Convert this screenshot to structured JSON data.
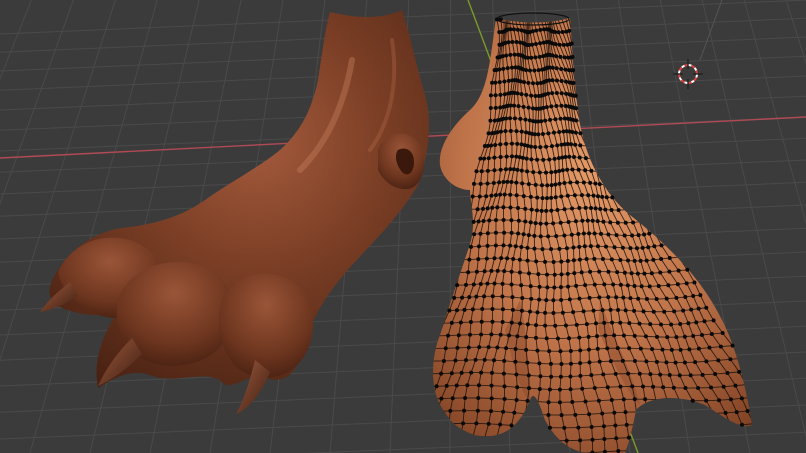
{
  "viewport": {
    "name": "3D Viewport",
    "background_color": "#3b3b3b",
    "grid_color": "#4a4a4a",
    "x_axis_color": "#b04a55",
    "y_axis_color": "#7c9a2a"
  },
  "objects": [
    {
      "id": "sculpted-paw",
      "kind": "sculpt",
      "shading": "smooth",
      "color": "#7a3e25"
    },
    {
      "id": "retopo-paw",
      "kind": "mesh",
      "mode": "edit",
      "shading": "smooth",
      "color": "#c0744a",
      "wire_color": "#111111"
    }
  ],
  "cursor": {
    "icon": "3d-cursor-icon",
    "colors": [
      "#e04040",
      "#ffffff"
    ]
  }
}
